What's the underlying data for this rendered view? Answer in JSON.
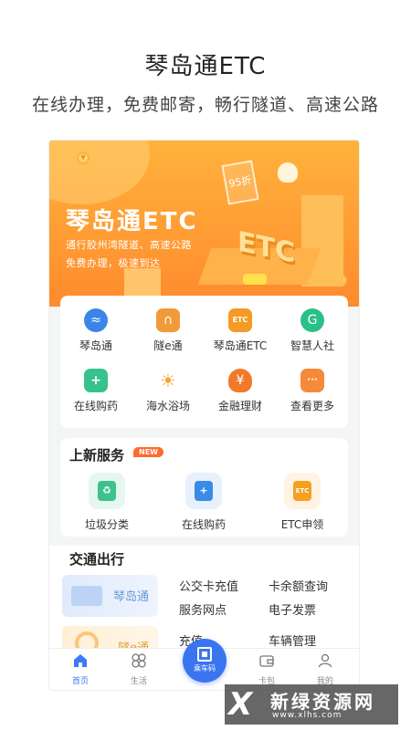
{
  "headline": "琴岛通ETC",
  "subline": "在线办理，免费邮寄，畅行隧道、高速公路",
  "banner": {
    "title": "琴岛通ETC",
    "line1": "通行胶州湾隧道、高速公路",
    "line2": "免费办理，极速到达",
    "discount_tag": "95折",
    "etc_art": "ETC"
  },
  "grid": [
    {
      "label": "琴岛通",
      "icon": "wave-logo-icon",
      "color": "#3a86e8",
      "glyph": "≈"
    },
    {
      "label": "隧e通",
      "icon": "tunnel-icon",
      "color": "#f29a3a",
      "glyph": "∩"
    },
    {
      "label": "琴岛通ETC",
      "icon": "etc-card-icon",
      "color": "#f59a25",
      "glyph": "ETC"
    },
    {
      "label": "智慧人社",
      "icon": "social-security-icon",
      "color": "#2bbf8a",
      "glyph": "G"
    },
    {
      "label": "在线购药",
      "icon": "medicine-icon",
      "color": "#35c28c",
      "glyph": "+"
    },
    {
      "label": "海水浴场",
      "icon": "beach-sun-icon",
      "color": "#f2a42c",
      "glyph": "☀"
    },
    {
      "label": "金融理财",
      "icon": "money-bag-icon",
      "color": "#f07a2a",
      "glyph": "¥"
    },
    {
      "label": "查看更多",
      "icon": "more-dots-icon",
      "color": "#f58a3a",
      "glyph": "···"
    }
  ],
  "services": {
    "title": "上新服务",
    "badge": "NEW",
    "items": [
      {
        "label": "垃圾分类",
        "icon": "recycle-bin-icon",
        "bg": "#e6f7f0",
        "color": "#3cc28d",
        "glyph": "♻"
      },
      {
        "label": "在线购药",
        "icon": "medicine-icon",
        "bg": "#e7f1fc",
        "color": "#3a8ae8",
        "glyph": "+"
      },
      {
        "label": "ETC申领",
        "icon": "etc-card-icon",
        "bg": "#fff3e3",
        "color": "#f5a020",
        "glyph": "ETC"
      }
    ]
  },
  "traffic": {
    "title": "交通出行",
    "card1_label": "琴岛通",
    "card2_label": "隧e通",
    "links": [
      "公交卡充值",
      "卡余额查询",
      "服务网点",
      "电子发票",
      "充值",
      "车辆管理"
    ]
  },
  "tabbar": {
    "tabs": [
      {
        "label": "首页",
        "icon": "home-icon"
      },
      {
        "label": "生活",
        "icon": "clover-icon"
      },
      {
        "label": "卡包",
        "icon": "wallet-icon"
      },
      {
        "label": "我的",
        "icon": "user-icon"
      }
    ],
    "fab_label": "乘车码"
  },
  "watermark": {
    "main": "新绿资源网",
    "sub": "www.xlhs.com"
  },
  "colors": {
    "accent": "#3a74f0",
    "banner": "#ff9b33",
    "badge": "#ff6a2c"
  }
}
